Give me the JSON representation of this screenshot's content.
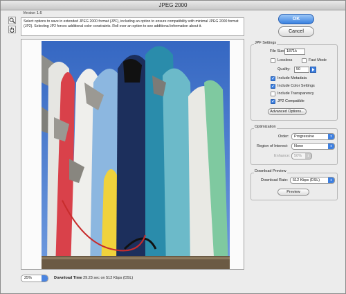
{
  "window": {
    "title": "JPEG 2000",
    "version": "Version 1.6"
  },
  "description": "Select options to save in extended JPEG 2000 format (JPF), including an option to ensure compatibility with minimal JPEG 2000 format (JP2). Selecting JP2 forces additional color constraints. Roll over an option to see additional information about it.",
  "buttons": {
    "ok": "OK",
    "cancel": "Cancel"
  },
  "jpf_settings": {
    "title": "JPF Settings",
    "file_size_label": "File Size:",
    "file_size_value": "1871k",
    "lossless_label": "Lossless",
    "fast_mode_label": "Fast Mode",
    "quality_label": "Quality:",
    "quality_value": "50",
    "include_metadata": "Include Metadata",
    "include_color_settings": "Include Color Settings",
    "include_transparency": "Include Transparency",
    "jp2_compatible": "JP2 Compatible",
    "advanced_options": "Advanced Options..."
  },
  "optimization": {
    "title": "Optimization",
    "order_label": "Order:",
    "order_value": "Progressive",
    "roi_label": "Region of Interest:",
    "roi_value": "None",
    "enhance_label": "Enhance:",
    "enhance_value": "50%"
  },
  "download_preview": {
    "title": "Download Preview",
    "rate_label": "Download Rate:",
    "rate_value": "512 Kbps (DSL)",
    "preview_button": "Preview"
  },
  "status": {
    "zoom": "25%",
    "download_time_label": "Download Time",
    "download_time_value": "29.23 sec on 512 Kbps (DSL)"
  },
  "colors": {
    "accent": "#3b7fe0",
    "sky": "#3d72c9"
  },
  "icons": [
    "zoom-icon",
    "hand-icon"
  ]
}
